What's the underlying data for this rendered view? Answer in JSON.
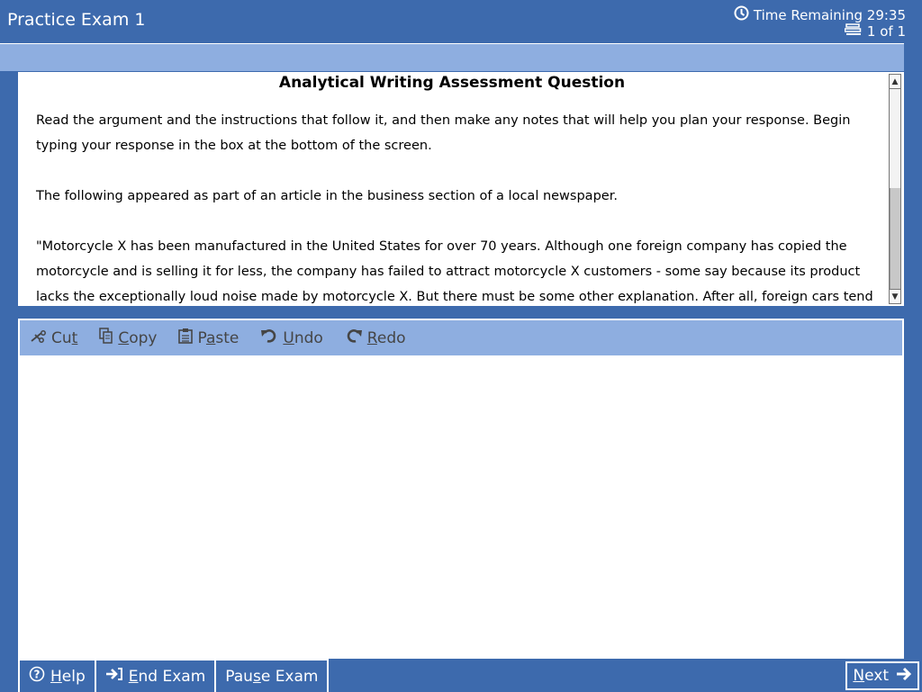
{
  "header": {
    "title": "Practice Exam 1",
    "timer_label": "Time Remaining 29:35",
    "question_counter": "1 of 1",
    "icons": {
      "timer": "clock-icon",
      "counter": "question-list-icon"
    }
  },
  "question": {
    "heading": "Analytical Writing Assessment Question",
    "paragraphs": [
      "Read the argument and the instructions that follow it, and then make any notes that will help you plan your response. Begin typing your response in the box at the bottom of the screen.",
      "The following appeared as part of an article in the business section of a local newspaper.",
      "\"Motorcycle X has been manufactured in the United States for over 70 years. Although one foreign company has copied the motorcycle and is selling it for less, the company has failed to attract motorcycle X customers - some say because its product lacks the exceptionally loud noise made by motorcycle X. But there must be some other explanation. After all, foreign cars tend to be"
    ]
  },
  "editor": {
    "toolbar": {
      "cut": {
        "pre": "Cu",
        "u": "t",
        "post": "",
        "icon": "scissors-icon"
      },
      "copy": {
        "pre": "",
        "u": "C",
        "post": "opy",
        "icon": "copy-icon"
      },
      "paste": {
        "pre": "P",
        "u": "a",
        "post": "ste",
        "icon": "clipboard-icon"
      },
      "undo": {
        "pre": "",
        "u": "U",
        "post": "ndo",
        "icon": "undo-icon"
      },
      "redo": {
        "pre": "",
        "u": "R",
        "post": "edo",
        "icon": "redo-icon"
      }
    },
    "response_value": ""
  },
  "footer": {
    "help": {
      "pre": "",
      "u": "H",
      "post": "elp",
      "icon": "help-circle-icon"
    },
    "end_exam": {
      "pre": "",
      "u": "E",
      "post": "nd Exam",
      "icon": "exit-icon"
    },
    "pause_exam": {
      "pre": "Pau",
      "u": "s",
      "post": "e Exam"
    },
    "next": {
      "pre": "",
      "u": "N",
      "post": "ext",
      "icon": "arrow-right-icon"
    }
  },
  "colors": {
    "primary_blue": "#3d6aad",
    "light_blue": "#8eaee0",
    "toolbar_text": "#454545"
  }
}
